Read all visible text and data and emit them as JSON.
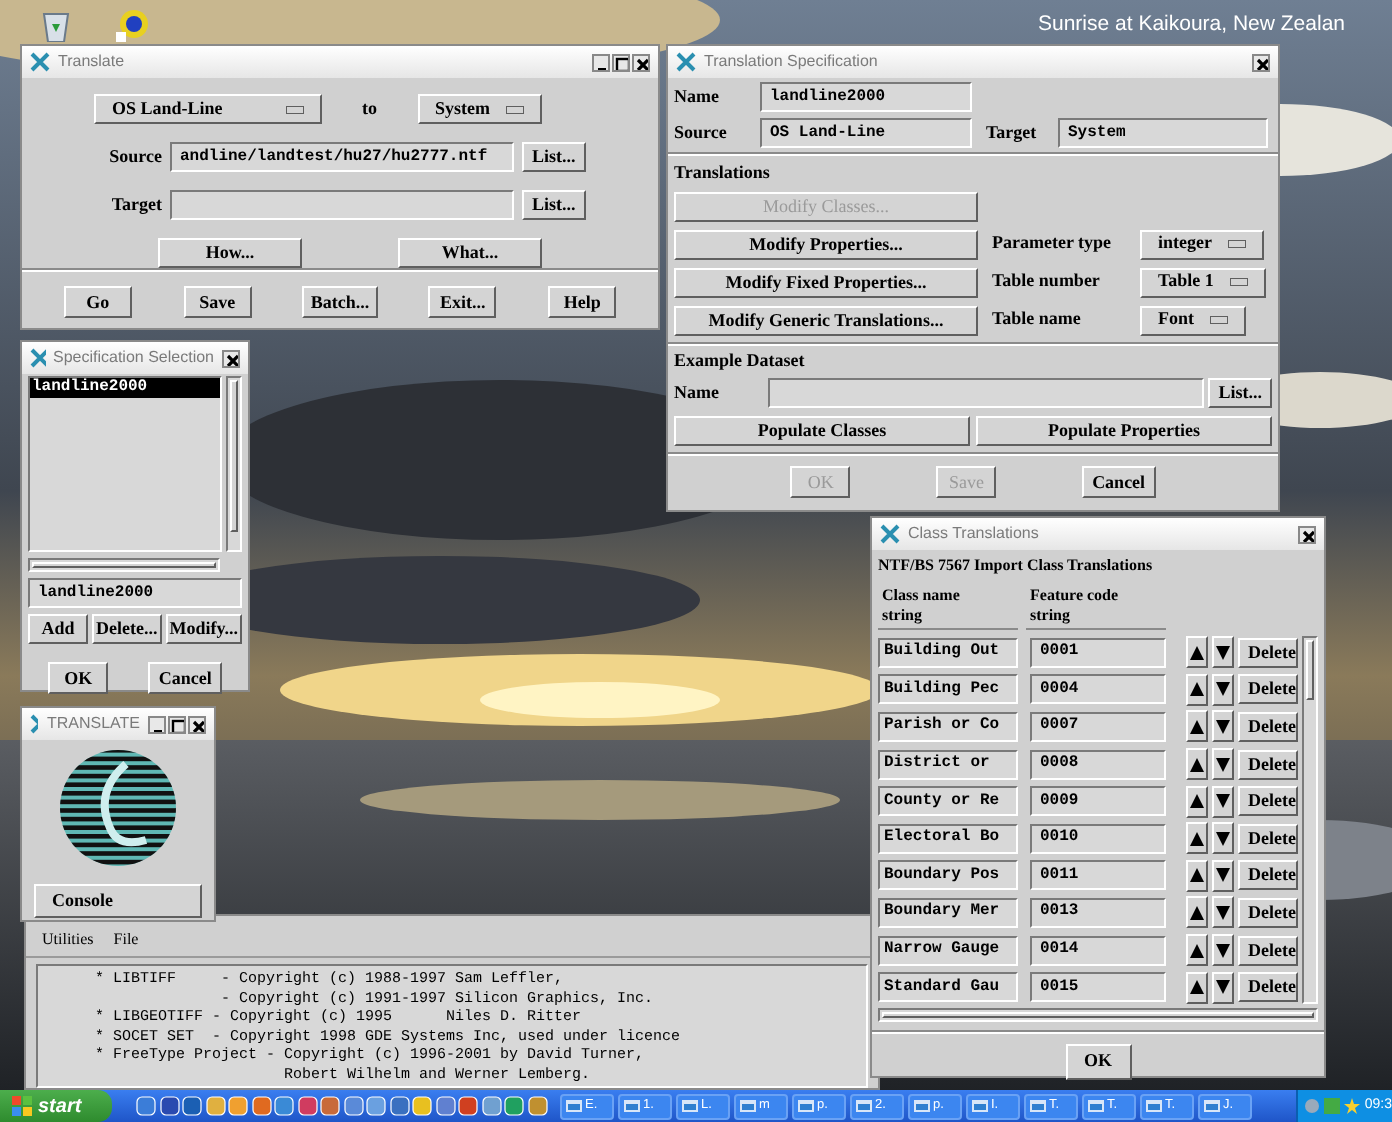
{
  "desktop": {
    "caption": "Sunrise at Kaikoura, New Zealan"
  },
  "translate": {
    "title": "Translate",
    "source_format": "OS Land-Line",
    "to_label": "to",
    "target_format": "System",
    "fields": [
      {
        "label": "Source",
        "value": "andline/landtest/hu27/hu2777.ntf",
        "button": "List..."
      },
      {
        "label": "Target",
        "button": "List..."
      }
    ],
    "middle_buttons": [
      "How...",
      "What..."
    ],
    "buttons": [
      "Go",
      "Save",
      "Batch...",
      "Exit...",
      "Help"
    ]
  },
  "specification": {
    "title": "Translation Specification",
    "name_label": "Name",
    "name": "landline2000",
    "source_label": "Source",
    "source": "OS Land-Line",
    "target_label": "Target",
    "target": "System",
    "translations_heading": "Translations",
    "modify_buttons": [
      {
        "label": "Modify Classes...",
        "disabled": true
      },
      {
        "label": "Modify Properties...",
        "disabled": false
      },
      {
        "label": "Modify Fixed Properties...",
        "disabled": false
      },
      {
        "label": "Modify Generic Translations...",
        "disabled": false
      }
    ],
    "parameters": [
      {
        "label": "Parameter type",
        "value": "integer"
      },
      {
        "label": "Table number",
        "value": "Table 1"
      },
      {
        "label": "Table name",
        "value": "Font"
      }
    ],
    "dataset_heading": "Example Dataset",
    "dataset_name_label": "Name",
    "dataset_list_button": "List...",
    "populate_buttons": [
      "Populate Classes",
      "Populate Properties"
    ],
    "footer_buttons": [
      {
        "label": "OK",
        "disabled": true
      },
      {
        "label": "Save",
        "disabled": true
      },
      {
        "label": "Cancel",
        "disabled": false
      }
    ]
  },
  "selection": {
    "title": "Specification Selection",
    "items": [
      {
        "label": "landline2000",
        "selected": true
      }
    ],
    "value": "landline2000",
    "buttons": [
      "Add",
      "Delete...",
      "Modify..."
    ],
    "footer_buttons": [
      "OK",
      "Cancel"
    ]
  },
  "splash": {
    "title": "TRANSLATE",
    "button": "Console"
  },
  "console": {
    "menu": [
      "Utilities",
      "File"
    ],
    "lines": [
      "     * LIBTIFF     - Copyright (c) 1988-1997 Sam Leffler,",
      "                   - Copyright (c) 1991-1997 Silicon Graphics, Inc.",
      "     * LIBGEOTIFF - Copyright (c) 1995      Niles D. Ritter",
      "     * SOCET SET  - Copyright 1998 GDE Systems Inc, used under licence",
      "     * FreeType Project - Copyright (c) 1996-2001 by David Turner,",
      "                          Robert Wilhelm and Werner Lemberg."
    ]
  },
  "class_translations": {
    "title": "Class Translations",
    "heading": "NTF/BS 7567 Import Class Translations",
    "columns": [
      {
        "label": "Class name",
        "sub": "string"
      },
      {
        "label": "Feature code",
        "sub": "string"
      }
    ],
    "rows": [
      {
        "name": "Building Out",
        "code": "0001",
        "action": "Delete"
      },
      {
        "name": "Building Pec",
        "code": "0004",
        "action": "Delete"
      },
      {
        "name": "Parish or Co",
        "code": "0007",
        "action": "Delete"
      },
      {
        "name": "District or",
        "code": "0008",
        "action": "Delete"
      },
      {
        "name": "County or Re",
        "code": "0009",
        "action": "Delete"
      },
      {
        "name": "Electoral Bo",
        "code": "0010",
        "action": "Delete"
      },
      {
        "name": "Boundary Pos",
        "code": "0011",
        "action": "Delete"
      },
      {
        "name": "Boundary Mer",
        "code": "0013",
        "action": "Delete"
      },
      {
        "name": "Narrow Gauge",
        "code": "0014",
        "action": "Delete"
      },
      {
        "name": "Standard Gau",
        "code": "0015",
        "action": "Delete"
      }
    ],
    "button": "OK"
  },
  "taskbar": {
    "start": "start",
    "tasks": [
      {
        "label": "E."
      },
      {
        "label": "1."
      },
      {
        "label": "L."
      },
      {
        "label": "m"
      },
      {
        "label": "p."
      },
      {
        "label": "2."
      },
      {
        "label": "p."
      },
      {
        "label": "I."
      },
      {
        "label": "T."
      },
      {
        "label": "T."
      },
      {
        "label": "T."
      },
      {
        "label": "J."
      }
    ],
    "clock": "09:3"
  }
}
